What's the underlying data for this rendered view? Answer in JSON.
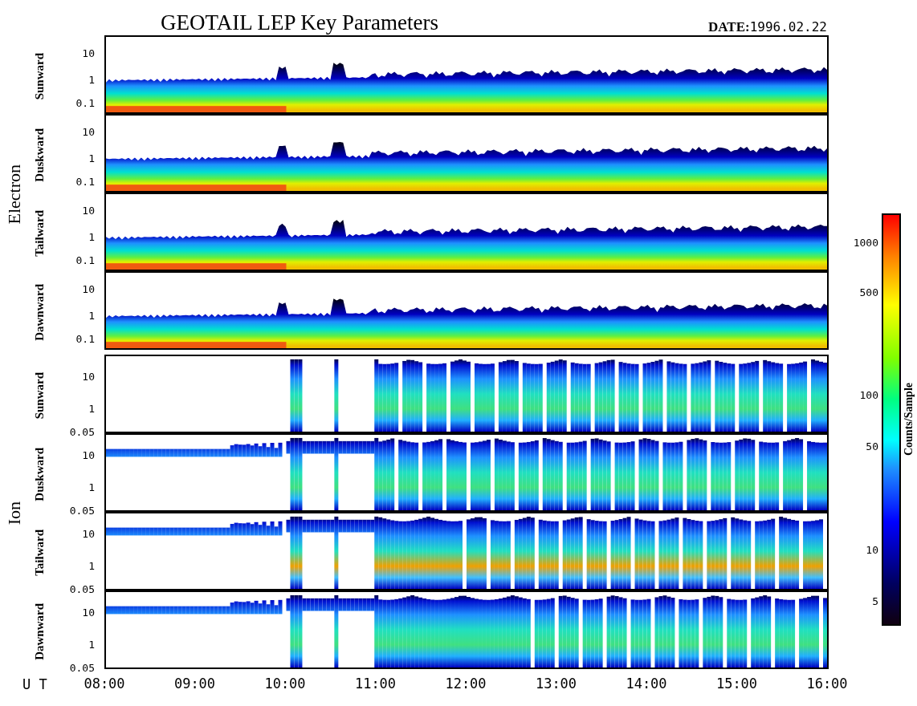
{
  "title": "GEOTAIL LEP Key Parameters",
  "date": {
    "label": "DATE:",
    "value": "1996.02.22"
  },
  "groups": [
    {
      "kind": "electron",
      "label": "Electron",
      "panels": [
        {
          "label": "Sunward",
          "y_ticks": [
            "10",
            "1",
            "0.1"
          ]
        },
        {
          "label": "Duskward",
          "y_ticks": [
            "10",
            "1",
            "0.1"
          ]
        },
        {
          "label": "Tailward",
          "y_ticks": [
            "10",
            "1",
            "0.1"
          ]
        },
        {
          "label": "Dawnward",
          "y_ticks": [
            "10",
            "1",
            "0.1"
          ]
        }
      ]
    },
    {
      "kind": "ion",
      "label": "Ion",
      "panels": [
        {
          "label": "Sunward",
          "y_ticks": [
            "10",
            "1",
            "0.05"
          ]
        },
        {
          "label": "Duskward",
          "y_ticks": [
            "10",
            "1",
            "0.05"
          ]
        },
        {
          "label": "Tailward",
          "y_ticks": [
            "10",
            "1",
            "0.05"
          ]
        },
        {
          "label": "Dawnward",
          "y_ticks": [
            "10",
            "1",
            "0.05"
          ]
        }
      ]
    }
  ],
  "x_axis": {
    "label": "U T",
    "ticks": [
      "08:00",
      "09:00",
      "10:00",
      "11:00",
      "12:00",
      "13:00",
      "14:00",
      "15:00",
      "16:00"
    ]
  },
  "colorbar": {
    "title": "Counts/Sample",
    "ticks": [
      "1000",
      "500",
      "100",
      "50",
      "10",
      "5"
    ]
  }
}
